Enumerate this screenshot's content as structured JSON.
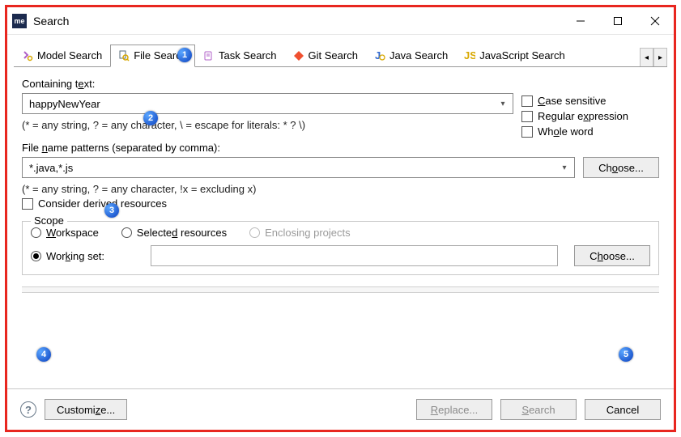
{
  "window": {
    "app_icon_text": "me",
    "title": "Search"
  },
  "tabs": {
    "model": "Model Search",
    "file": "File Search",
    "task": "Task Search",
    "git": "Git Search",
    "java": "Java Search",
    "javascript": "JavaScript Search"
  },
  "labels": {
    "containing_pre": "Containing t",
    "containing_u": "e",
    "containing_post": "xt:",
    "hint1": "(* = any string, ? = any character, \\ = escape for literals: * ? \\)",
    "filename_pre": "File ",
    "filename_u": "n",
    "filename_post": "ame patterns (separated by comma):",
    "hint2": "(* = any string, ? = any character, !x = excluding x)",
    "consider": "Consider derived resources",
    "case_pre": "",
    "case_u": "C",
    "case_post": "ase sensitive",
    "regex_pre": "Regular e",
    "regex_u": "x",
    "regex_post": "pression",
    "whole_pre": "Wh",
    "whole_u": "o",
    "whole_post": "le word",
    "scope": "Scope",
    "workspace_pre": "",
    "workspace_u": "W",
    "workspace_post": "orkspace",
    "selected_pre": "Selecte",
    "selected_u": "d",
    "selected_post": " resources",
    "enclosing": "Enclosing projects",
    "workingset_pre": "Wor",
    "workingset_u": "k",
    "workingset_post": "ing set:",
    "choose_pre": "Ch",
    "choose_u": "o",
    "choose_post": "ose...",
    "choose2_pre": "C",
    "choose2_u": "h",
    "choose2_post": "oose...",
    "customize_pre": "Customi",
    "customize_u": "z",
    "customize_post": "e...",
    "replace_pre": "",
    "replace_u": "R",
    "replace_post": "eplace...",
    "search_pre": "",
    "search_u": "S",
    "search_post": "earch",
    "cancel": "Cancel"
  },
  "inputs": {
    "containing_value": "happyNewYear",
    "filename_value": "*.java,*.js"
  },
  "callouts": {
    "c1": "1",
    "c2": "2",
    "c3": "3",
    "c4": "4",
    "c5": "5"
  }
}
